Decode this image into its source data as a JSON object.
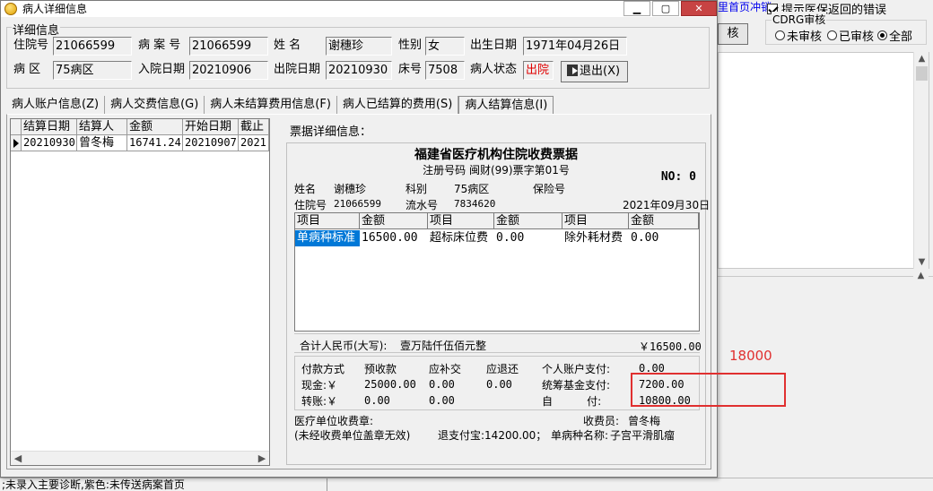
{
  "background": {
    "link_text": "里首页冲销",
    "checkbox_label": "提示医保返回的错误",
    "group_title": "CDRG审核",
    "button_label": "核",
    "radios": [
      "未审核",
      "已审核",
      "全部"
    ],
    "status_text": ";未录入主要诊断,紫色:未传送病案首页"
  },
  "dialog": {
    "title": "病人详细信息",
    "group_title": "详细信息",
    "fields": {
      "admission_no_label": "住院号",
      "admission_no": "21066599",
      "case_no_label": "病 案 号",
      "case_no": "21066599",
      "name_label": "姓     名",
      "name": "谢穗珍",
      "sex_label": "性别",
      "sex": "女",
      "birth_label": "出生日期",
      "birth": "1971年04月26日",
      "ward_label": "病   区",
      "ward": "75病区",
      "in_date_label": "入院日期",
      "in_date": "20210906",
      "out_date_label": "出院日期",
      "out_date": "20210930",
      "bed_label": "床号",
      "bed": "7508",
      "status_label": "病人状态",
      "status": "出院"
    },
    "exit_label": "退出(X)",
    "tabs": [
      "病人账户信息(Z)",
      "病人交费信息(G)",
      "病人未结算费用信息(F)",
      "病人已结算的费用(S)",
      "病人结算信息(I)"
    ],
    "grid": {
      "headers": [
        "结算日期",
        "结算人",
        "金额",
        "开始日期",
        "截止"
      ],
      "rows": [
        [
          "20210930",
          "曾冬梅",
          "16741.24",
          "20210907",
          "2021"
        ]
      ]
    },
    "receipt": {
      "section_label": "票据详细信息：",
      "title": "福建省医疗机构住院收费票据",
      "subtitle": "注册号码 闽财(99)票字第01号",
      "no": "NO: 0",
      "name_label": "姓名",
      "name": "谢穗珍",
      "dept_label": "科别",
      "dept": "75病区",
      "insurance_label": "保险号",
      "admission_label": "住院号",
      "admission": "21066599",
      "serial_label": "流水号",
      "serial": "7834620",
      "date": "2021年09月30日",
      "item_headers": [
        "项目",
        "金额",
        "项目",
        "金额",
        "项目",
        "金额"
      ],
      "items": [
        "单病种标准",
        "16500.00",
        "超标床位费",
        "0.00",
        "除外耗材费",
        "0.00"
      ],
      "total_label": "合计人民币(大写):",
      "total_words": "壹万陆仟伍佰元整",
      "total": "￥16500.00",
      "pay_headers": [
        "付款方式",
        "预收款",
        "应补交",
        "应退还",
        "个人账户支付:",
        "0.00"
      ],
      "cash_row": [
        "现金:￥",
        "25000.00",
        "0.00",
        "0.00",
        "统筹基金支付:",
        "7200.00"
      ],
      "transfer_row": [
        "转账:￥",
        "0.00",
        "0.00",
        "自          付:",
        "10800.00"
      ],
      "footer": {
        "seal_label": "医疗单位收费章:",
        "cashier_label": "收费员:",
        "cashier": "曾冬梅",
        "note": "(未经收费单位盖章无效)",
        "refund": "退支付宝:14200.00；",
        "disease_label": "单病种名称:",
        "disease": "子宫平滑肌瘤"
      }
    }
  },
  "annotation": {
    "value": "18000",
    "color": "#e03030"
  }
}
